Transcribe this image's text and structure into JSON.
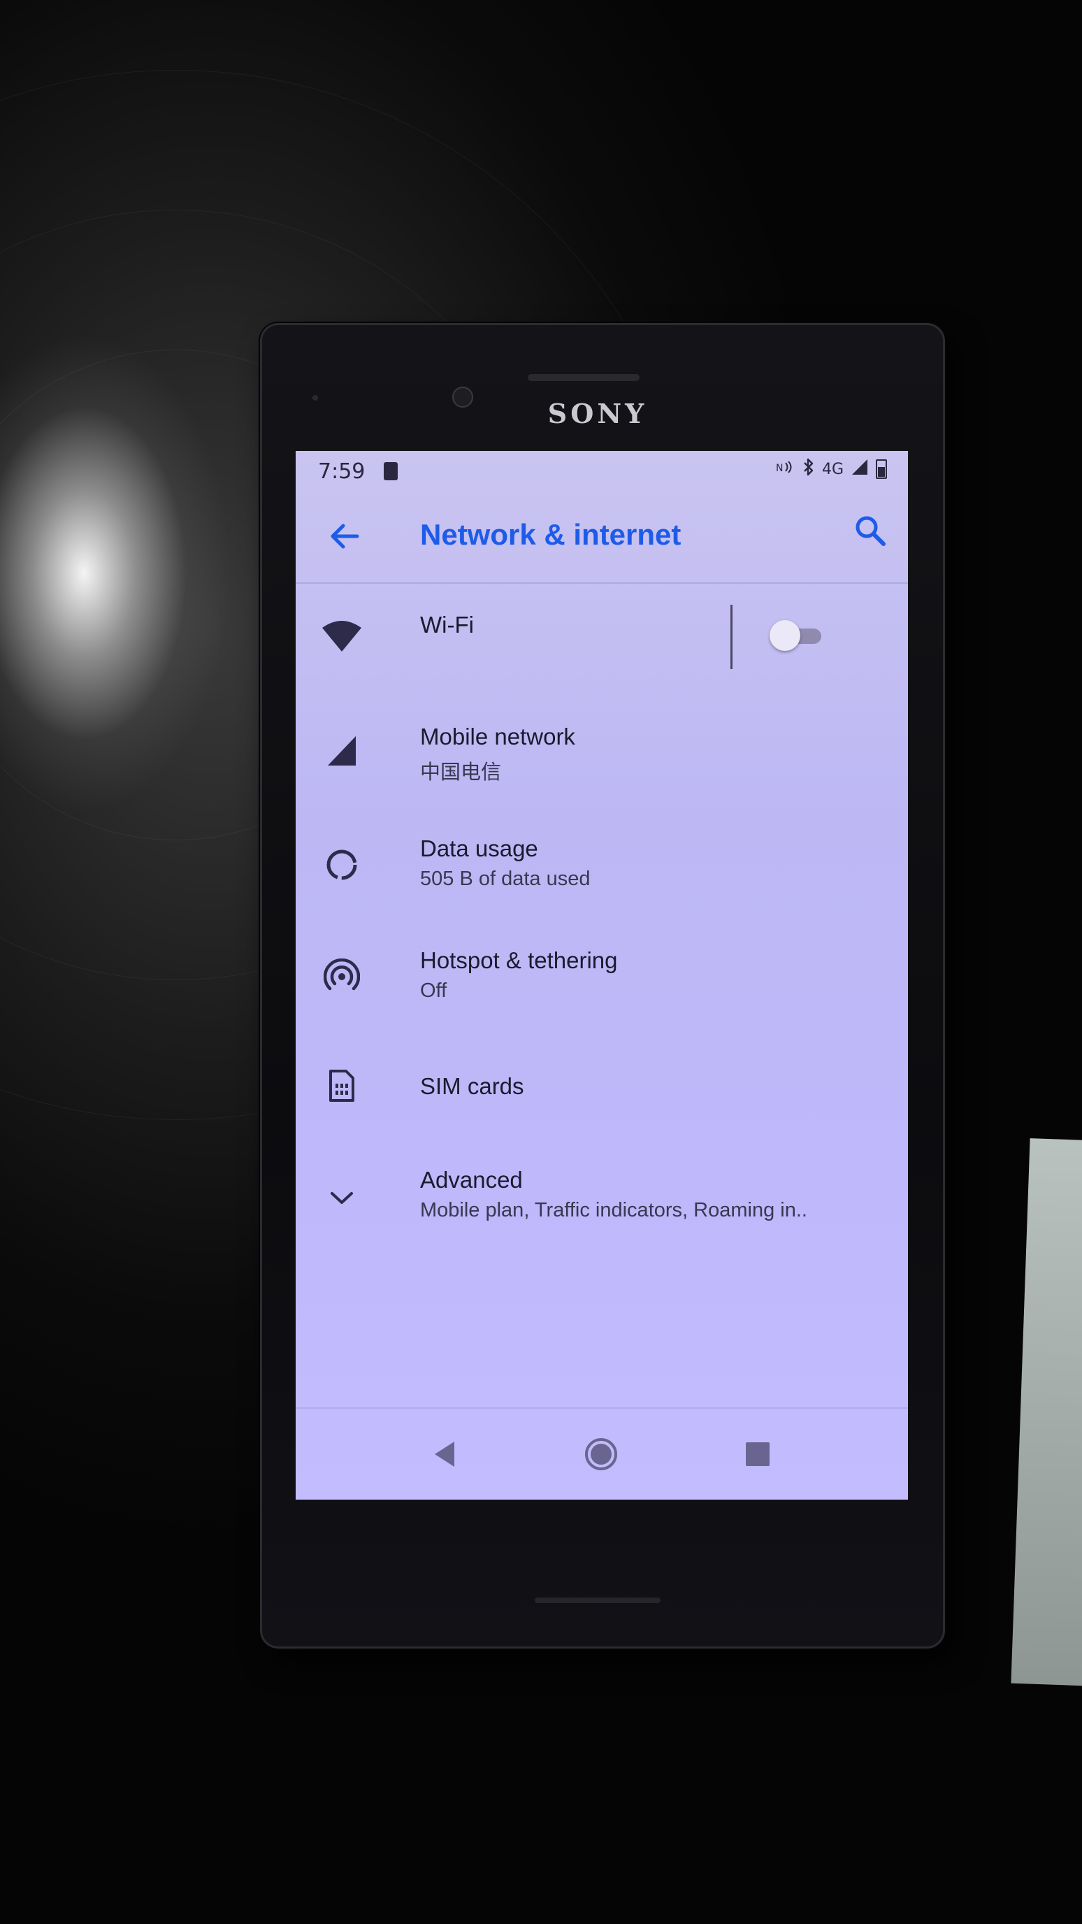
{
  "device": {
    "brand": "SONY"
  },
  "status_bar": {
    "time": "7:59",
    "network_type": "4G",
    "icons": [
      "notification-icon",
      "nfc-icon",
      "bluetooth-icon",
      "signal-icon",
      "battery-icon"
    ]
  },
  "toolbar": {
    "title": "Network & internet",
    "back_icon": "arrow-left-icon",
    "search_icon": "search-icon"
  },
  "settings": {
    "items": [
      {
        "title": "Wi-Fi",
        "icon": "wifi-icon",
        "toggle": "off"
      },
      {
        "title": "Mobile network",
        "subtitle": "中国电信",
        "icon": "cell-signal-icon"
      },
      {
        "title": "Data usage",
        "subtitle": "505 B of data used",
        "icon": "data-usage-icon"
      },
      {
        "title": "Hotspot & tethering",
        "subtitle": "Off",
        "icon": "hotspot-icon"
      },
      {
        "title": "SIM cards",
        "icon": "sim-card-icon"
      },
      {
        "title": "Advanced",
        "subtitle": "Mobile plan, Traffic indicators, Roaming in..",
        "icon": "chevron-down-icon"
      }
    ]
  },
  "nav_bar": {
    "buttons": [
      "back-triangle-icon",
      "home-circle-icon",
      "recents-square-icon"
    ]
  },
  "colors": {
    "accent": "#1e5be8",
    "screen_tint": "#c1bcf8",
    "icon": "#2e2a4a"
  }
}
